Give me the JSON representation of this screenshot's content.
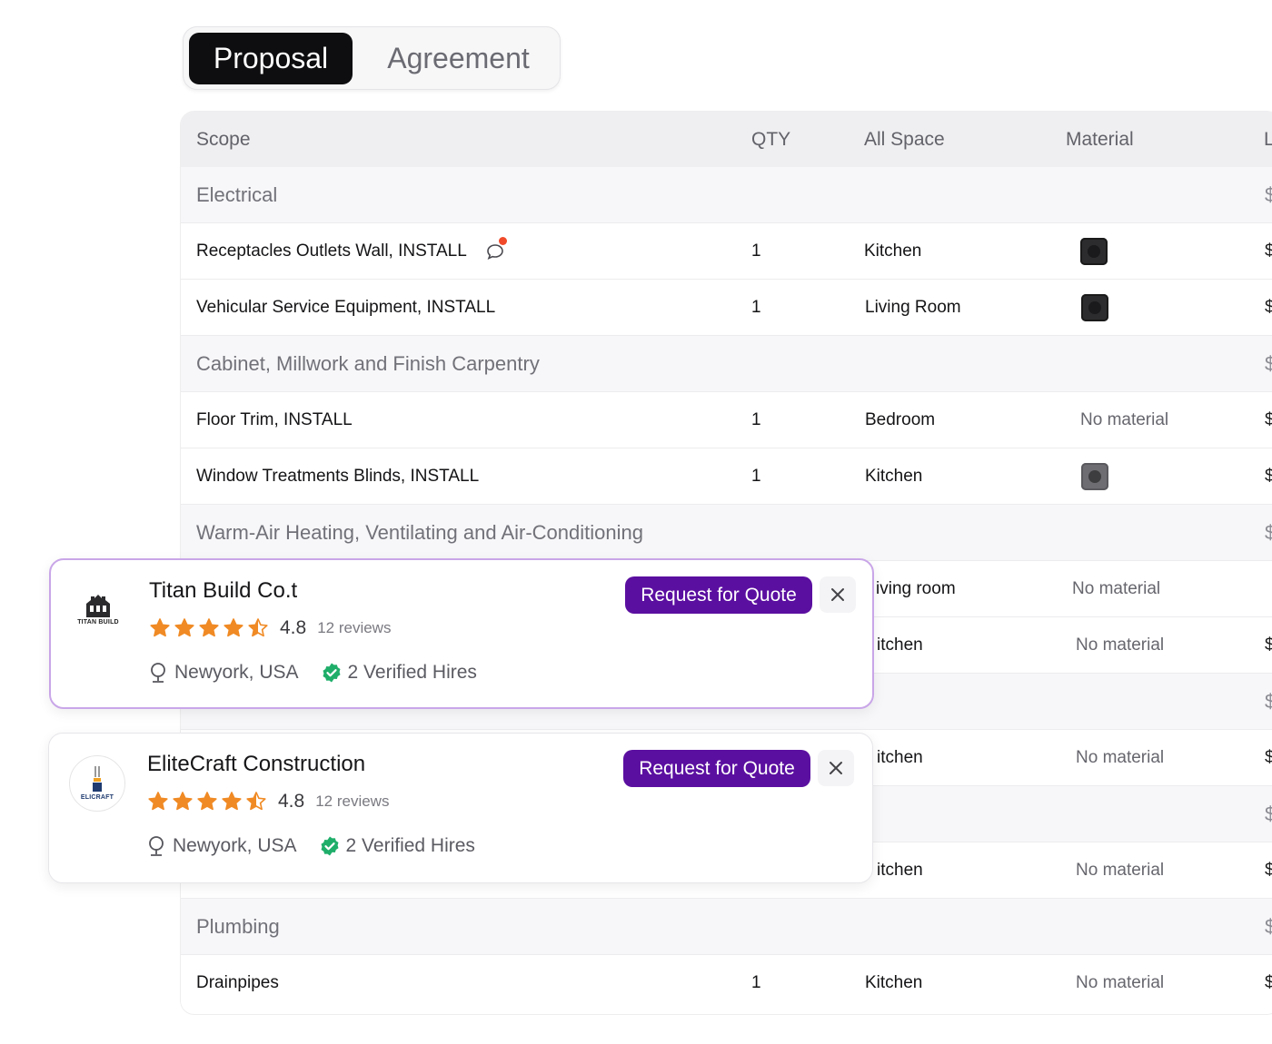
{
  "tabs": [
    {
      "label": "Proposal",
      "active": true
    },
    {
      "label": "Agreement",
      "active": false
    }
  ],
  "table": {
    "headers": {
      "scope": "Scope",
      "qty": "QTY",
      "space": "All Space",
      "material": "Material",
      "last": "L"
    },
    "rows": [
      {
        "type": "category",
        "scope": "Electrical",
        "price": "$"
      },
      {
        "type": "item",
        "scope": "Receptacles Outlets Wall, INSTALL",
        "qty": "1",
        "space": "Kitchen",
        "material": "",
        "swatch": "dark",
        "price": "$",
        "comment": true
      },
      {
        "type": "item",
        "scope": "Vehicular Service Equipment, INSTALL",
        "qty": "1",
        "space": "Living Room",
        "material": "",
        "swatch": "dark",
        "price": "$"
      },
      {
        "type": "category",
        "scope": "Cabinet, Millwork and Finish Carpentry",
        "price": "$"
      },
      {
        "type": "item",
        "scope": "Floor Trim, INSTALL",
        "qty": "1",
        "space": "Bedroom",
        "material": "No material",
        "price": "$"
      },
      {
        "type": "item",
        "scope": "Window Treatments Blinds, INSTALL",
        "qty": "1",
        "space": "Kitchen",
        "material": "",
        "swatch": "grey",
        "price": "$"
      },
      {
        "type": "category",
        "scope": "Warm-Air Heating, Ventilating and Air-Conditioning",
        "price": "$"
      },
      {
        "type": "item",
        "scope": "",
        "qty": "",
        "space": "iving room",
        "material": "No material",
        "price": ""
      },
      {
        "type": "item",
        "scope": "",
        "qty": "",
        "space": "itchen",
        "material": "No material",
        "price": "$"
      },
      {
        "type": "category",
        "scope": "",
        "price": "$"
      },
      {
        "type": "item",
        "scope": "",
        "qty": "",
        "space": "itchen",
        "material": "No material",
        "price": "$"
      },
      {
        "type": "category",
        "scope": "",
        "price": "$"
      },
      {
        "type": "item",
        "scope": "",
        "qty": "",
        "space": "itchen",
        "material": "No material",
        "price": "$"
      },
      {
        "type": "category",
        "scope": "Plumbing",
        "price": "$"
      },
      {
        "type": "item",
        "scope": "Drainpipes",
        "qty": "1",
        "space": "Kitchen",
        "material": "No material",
        "price": "$"
      }
    ]
  },
  "cards": [
    {
      "name": "Titan Build Co.t",
      "logo_text": "TITAN BUILD",
      "rating": "4.8",
      "stars": 4.5,
      "reviews": "12 reviews",
      "location": "Newyork, USA",
      "hires": "2 Verified Hires",
      "button": "Request for Quote"
    },
    {
      "name": "EliteCraft Construction",
      "logo_text": "ELICRAFT",
      "rating": "4.8",
      "stars": 4.5,
      "reviews": "12 reviews",
      "location": "Newyork, USA",
      "hires": "2 Verified Hires",
      "button": "Request for Quote"
    }
  ],
  "colors": {
    "accent": "#5b0fa0",
    "star": "#f08a24",
    "verified": "#1fae6a",
    "active_tab": "#0e0e10"
  }
}
